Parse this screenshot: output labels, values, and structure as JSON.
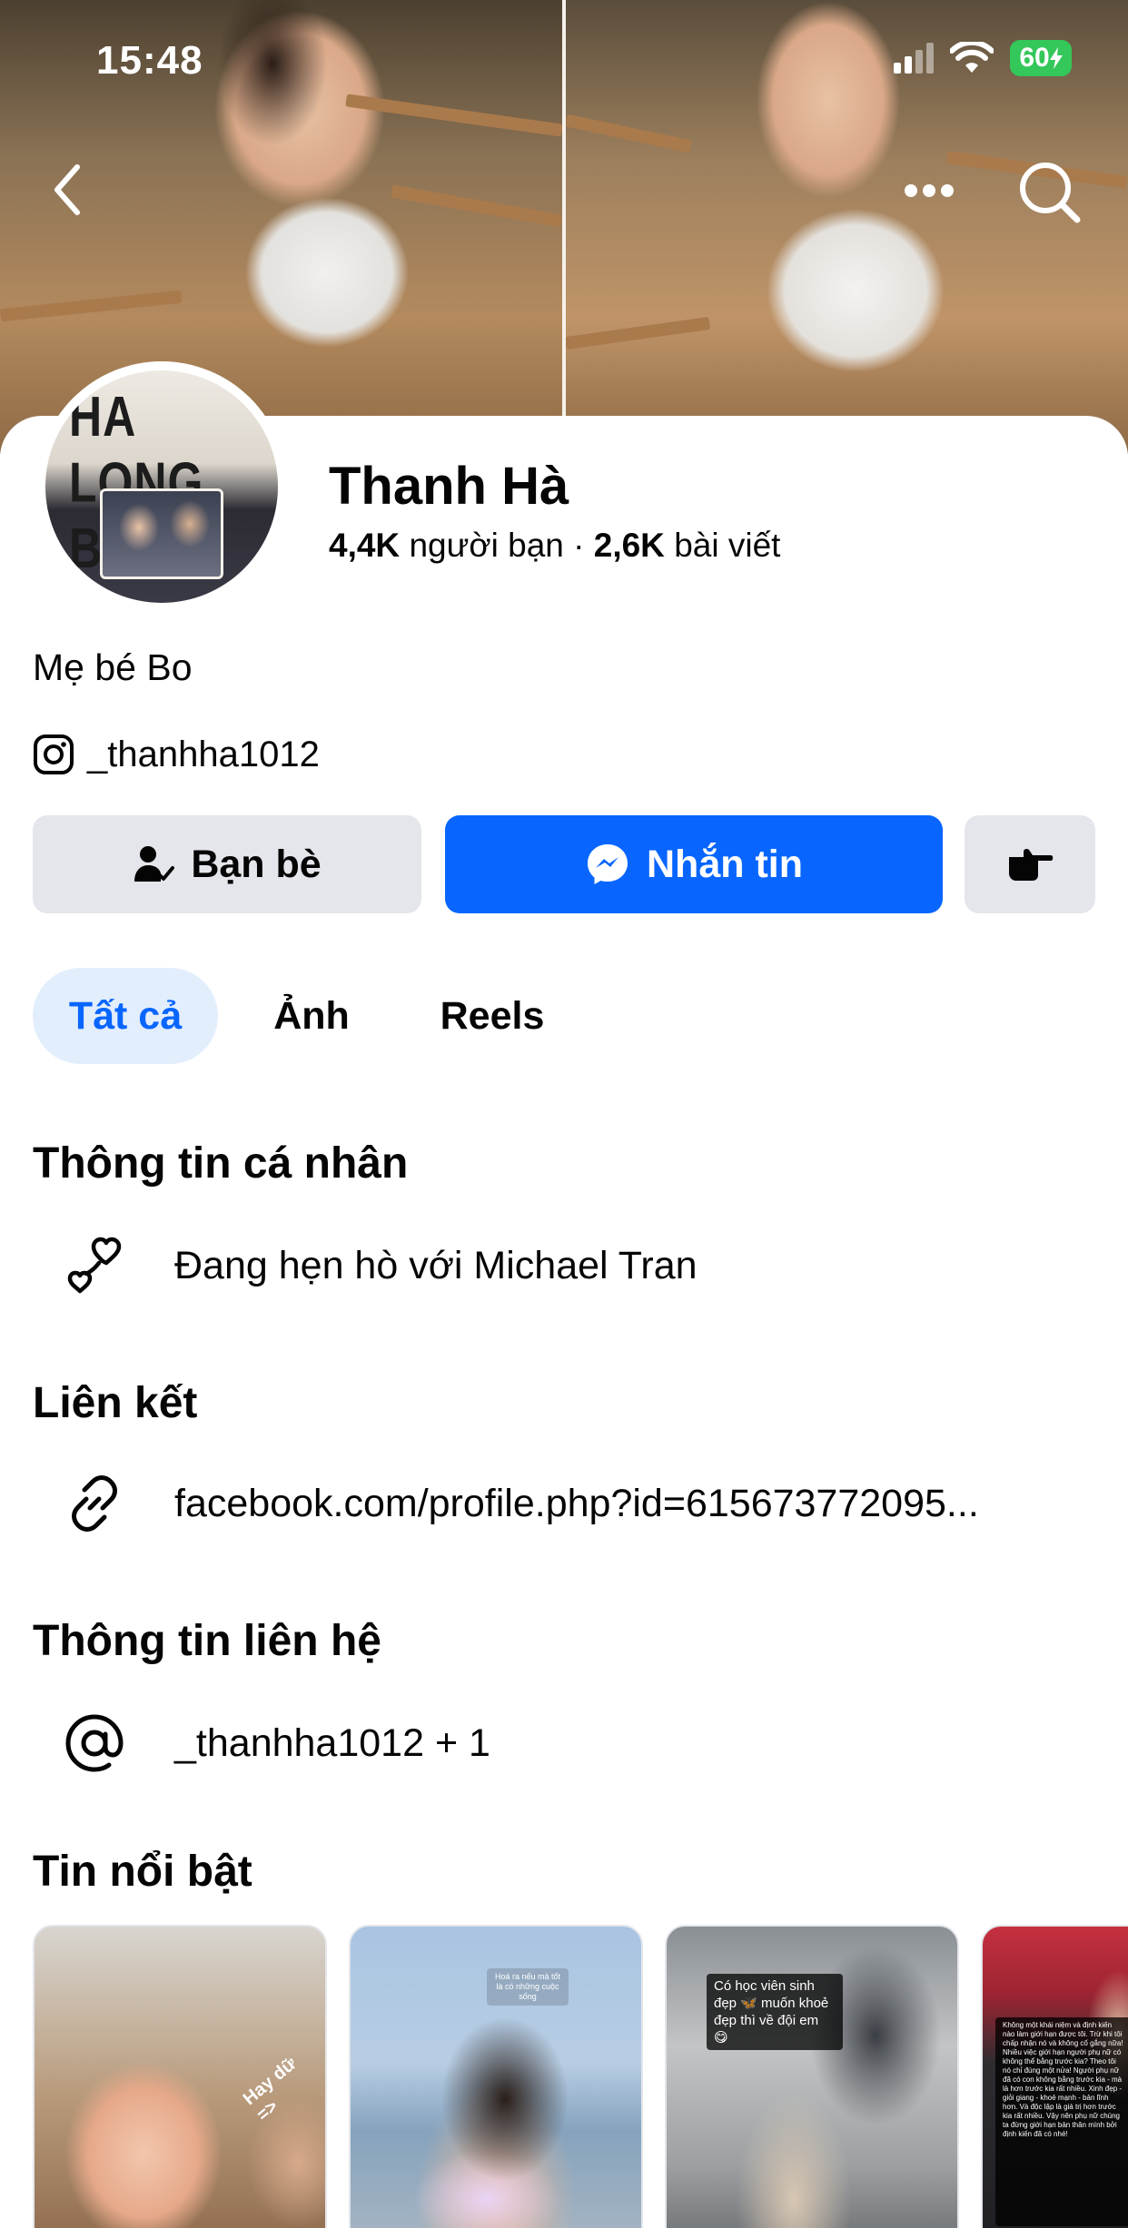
{
  "status_bar": {
    "time": "15:48",
    "battery": "60"
  },
  "colors": {
    "brand_blue": "#0866ff",
    "secondary_button": "#e4e6eb",
    "active_tab_bg": "#e3eefd",
    "battery_green": "#34c759"
  },
  "nav": {
    "back_icon": "chevron-left-icon",
    "more_icon": "more-horizontal-icon",
    "search_icon": "search-icon"
  },
  "avatar": {
    "sign_text": "HA LONG BAY"
  },
  "profile": {
    "name": "Thanh Hà",
    "friends_count": "4,4K",
    "friends_label": "người bạn",
    "separator": "·",
    "posts_count": "2,6K",
    "posts_label": "bài viết",
    "bio": "Mẹ bé Bo",
    "instagram": "_thanhha1012"
  },
  "actions": {
    "friends_label": "Bạn bè",
    "message_label": "Nhắn tin"
  },
  "tabs": [
    {
      "label": "Tất cả",
      "active": true
    },
    {
      "label": "Ảnh",
      "active": false
    },
    {
      "label": "Reels",
      "active": false
    }
  ],
  "sections": {
    "personal_info": {
      "title": "Thông tin cá nhân",
      "relationship": "Đang hẹn hò với Michael Tran"
    },
    "links": {
      "title": "Liên kết",
      "url": "facebook.com/profile.php?id=615673772095..."
    },
    "contact": {
      "title": "Thông tin liên hệ",
      "handle": "_thanhha1012 + 1"
    },
    "highlights": {
      "title": "Tin nổi bật",
      "items": [
        {
          "sticker": "Hay dữ =>"
        },
        {
          "caption": "Hoá ra nếu mà tốt là có những cuộc sống"
        },
        {
          "caption": "Có học viên sinh đẹp 🦋 muốn khoẻ đẹp thì về đội em 😋"
        },
        {
          "caption": "Không một khái niệm và định kiến nào làm giới hạn được tôi. Trừ khi tôi chấp nhận nó và không cố gắng nữa! Nhiều việc giới hạn người phụ nữ có không thể bằng trước kia? Theo tôi nó chỉ đúng một nửa! Người phụ nữ đã có con không bằng trước kia - mà là hơn trước kia rất nhiều. Xinh đẹp - giỏi giang - khoẻ mạnh - bản lĩnh hơn. Và độc lập là giá trị hơn trước kia rất nhiều. Vậy nên phụ nữ chúng ta đừng giới hạn bản thân mình bởi định kiến đã có nhé!"
        }
      ]
    }
  }
}
